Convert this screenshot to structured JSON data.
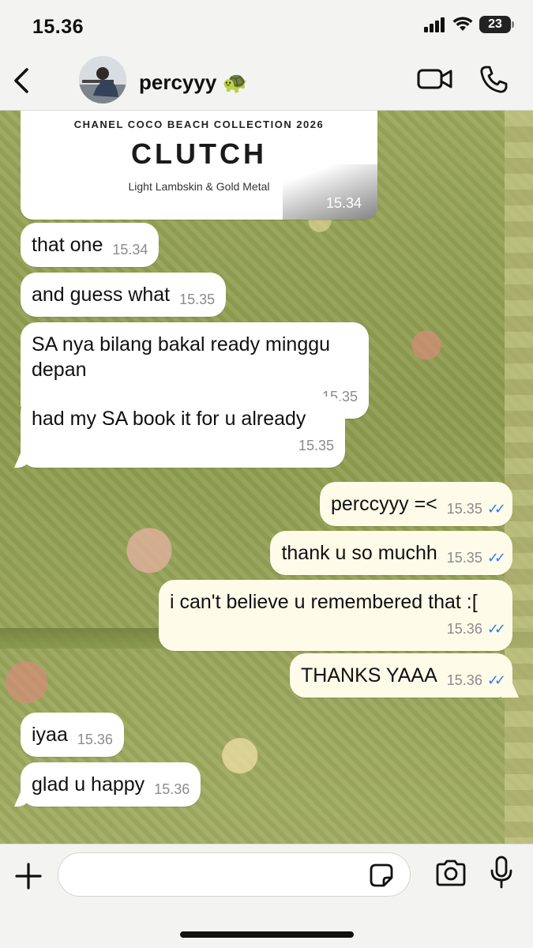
{
  "status_bar": {
    "time": "15.36",
    "battery": "23"
  },
  "header": {
    "contact_name": "percyyy 🐢"
  },
  "product_card": {
    "collection": "CHANEL COCO BEACH COLLECTION 2026",
    "product": "CLUTCH",
    "material": "Light Lambskin & Gold Metal",
    "time": "15.34"
  },
  "messages": [
    {
      "direction": "in",
      "text": "that one",
      "time": "15.34"
    },
    {
      "direction": "in",
      "text": "and guess what",
      "time": "15.35"
    },
    {
      "direction": "in",
      "text": "SA nya bilang bakal ready minggu depan",
      "time": "15.35"
    },
    {
      "direction": "in",
      "text": "had my SA book it for u already",
      "time": "15.35"
    },
    {
      "direction": "out",
      "text": "perccyyy =<",
      "time": "15.35",
      "read": true
    },
    {
      "direction": "out",
      "text": "thank u so muchh",
      "time": "15.35",
      "read": true
    },
    {
      "direction": "out",
      "text": "i can't believe u remembered that :[",
      "time": "15.36",
      "read": true
    },
    {
      "direction": "out",
      "text": "THANKS YAAA",
      "time": "15.36",
      "read": true
    },
    {
      "direction": "in",
      "text": "iyaa",
      "time": "15.36"
    },
    {
      "direction": "in",
      "text": "glad u happy",
      "time": "15.36"
    }
  ],
  "input": {
    "placeholder": ""
  },
  "colors": {
    "read_receipt": "#2e7cf0",
    "outgoing_bubble": "#fefbe9",
    "incoming_bubble": "#ffffff"
  },
  "icons": [
    "back-icon",
    "video-call-icon",
    "phone-icon",
    "plus-icon",
    "sticker-icon",
    "camera-icon",
    "microphone-icon",
    "signal-icon",
    "wifi-icon",
    "battery-icon",
    "double-check-icon"
  ]
}
